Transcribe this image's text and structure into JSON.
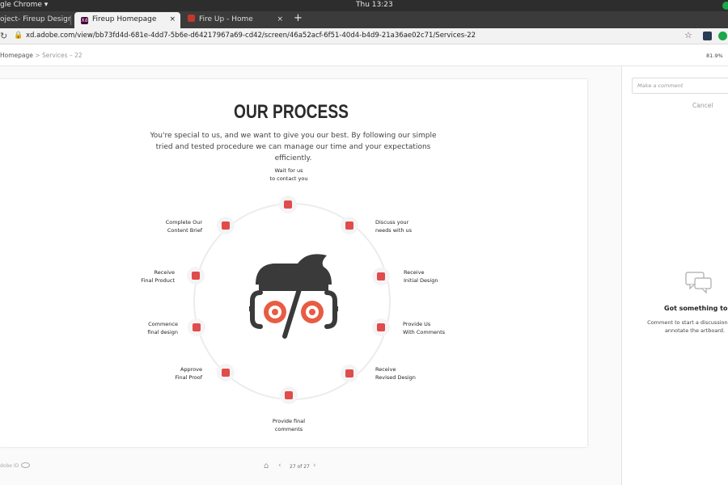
{
  "os": {
    "app_menu": "gle Chrome ▾",
    "clock": "Thu 13:23"
  },
  "tabs": [
    {
      "label": "oject- Fireup Design",
      "favicon": "adobe-xd-icon"
    },
    {
      "label": "Fireup Homepage",
      "favicon": "adobe-xd-icon"
    },
    {
      "label": "Fire Up - Home",
      "favicon": "fireup-icon"
    }
  ],
  "new_tab": "+",
  "tab_close": "×",
  "address": {
    "url": "xd.adobe.com/view/bb73fd4d-681e-4dd7-5b6e-d64217967a69-cd42/screen/46a52acf-6f51-40d4-b4d9-21a36ae02c71/Services-22"
  },
  "xd": {
    "breadcrumb_root": "Homepage",
    "breadcrumb_sep": " > ",
    "breadcrumb_page": "Services – 22",
    "zoom": "81.9%",
    "adobe_id": "dobe ID",
    "page_count": "27 of 27"
  },
  "artboard": {
    "title": "OUR PROCESS",
    "intro": "You're special to us, and we want to give you our best. By following our simple tried and tested procedure we can manage our time and your expectations efficiently.",
    "steps": [
      {
        "label": "Wait for us\nto contact you",
        "icon": "contact-icon"
      },
      {
        "label": "Discuss your\nneeds with us",
        "icon": "discuss-icon"
      },
      {
        "label": "Receive\nInitial Design",
        "icon": "initial-design-icon"
      },
      {
        "label": "Provide Us\nWith Comments",
        "icon": "comments-icon"
      },
      {
        "label": "Receive\nRevised Design",
        "icon": "revised-design-icon"
      },
      {
        "label": "Provide final\ncomments",
        "icon": "final-comments-icon"
      },
      {
        "label": "Approve\nFinal Proof",
        "icon": "approve-icon"
      },
      {
        "label": "Commence\nfinal design",
        "icon": "commence-icon"
      },
      {
        "label": "Receive\nFinal Product",
        "icon": "final-product-icon"
      },
      {
        "label": "Complete Our\nContent Brief",
        "icon": "content-brief-icon"
      }
    ],
    "accent_color": "#e85c42"
  },
  "comments_panel": {
    "placeholder": "Make a comment",
    "cancel": "Cancel",
    "empty_title": "Got something to say",
    "empty_text": "Comment to start a discussion, mak annotate the artboard."
  }
}
